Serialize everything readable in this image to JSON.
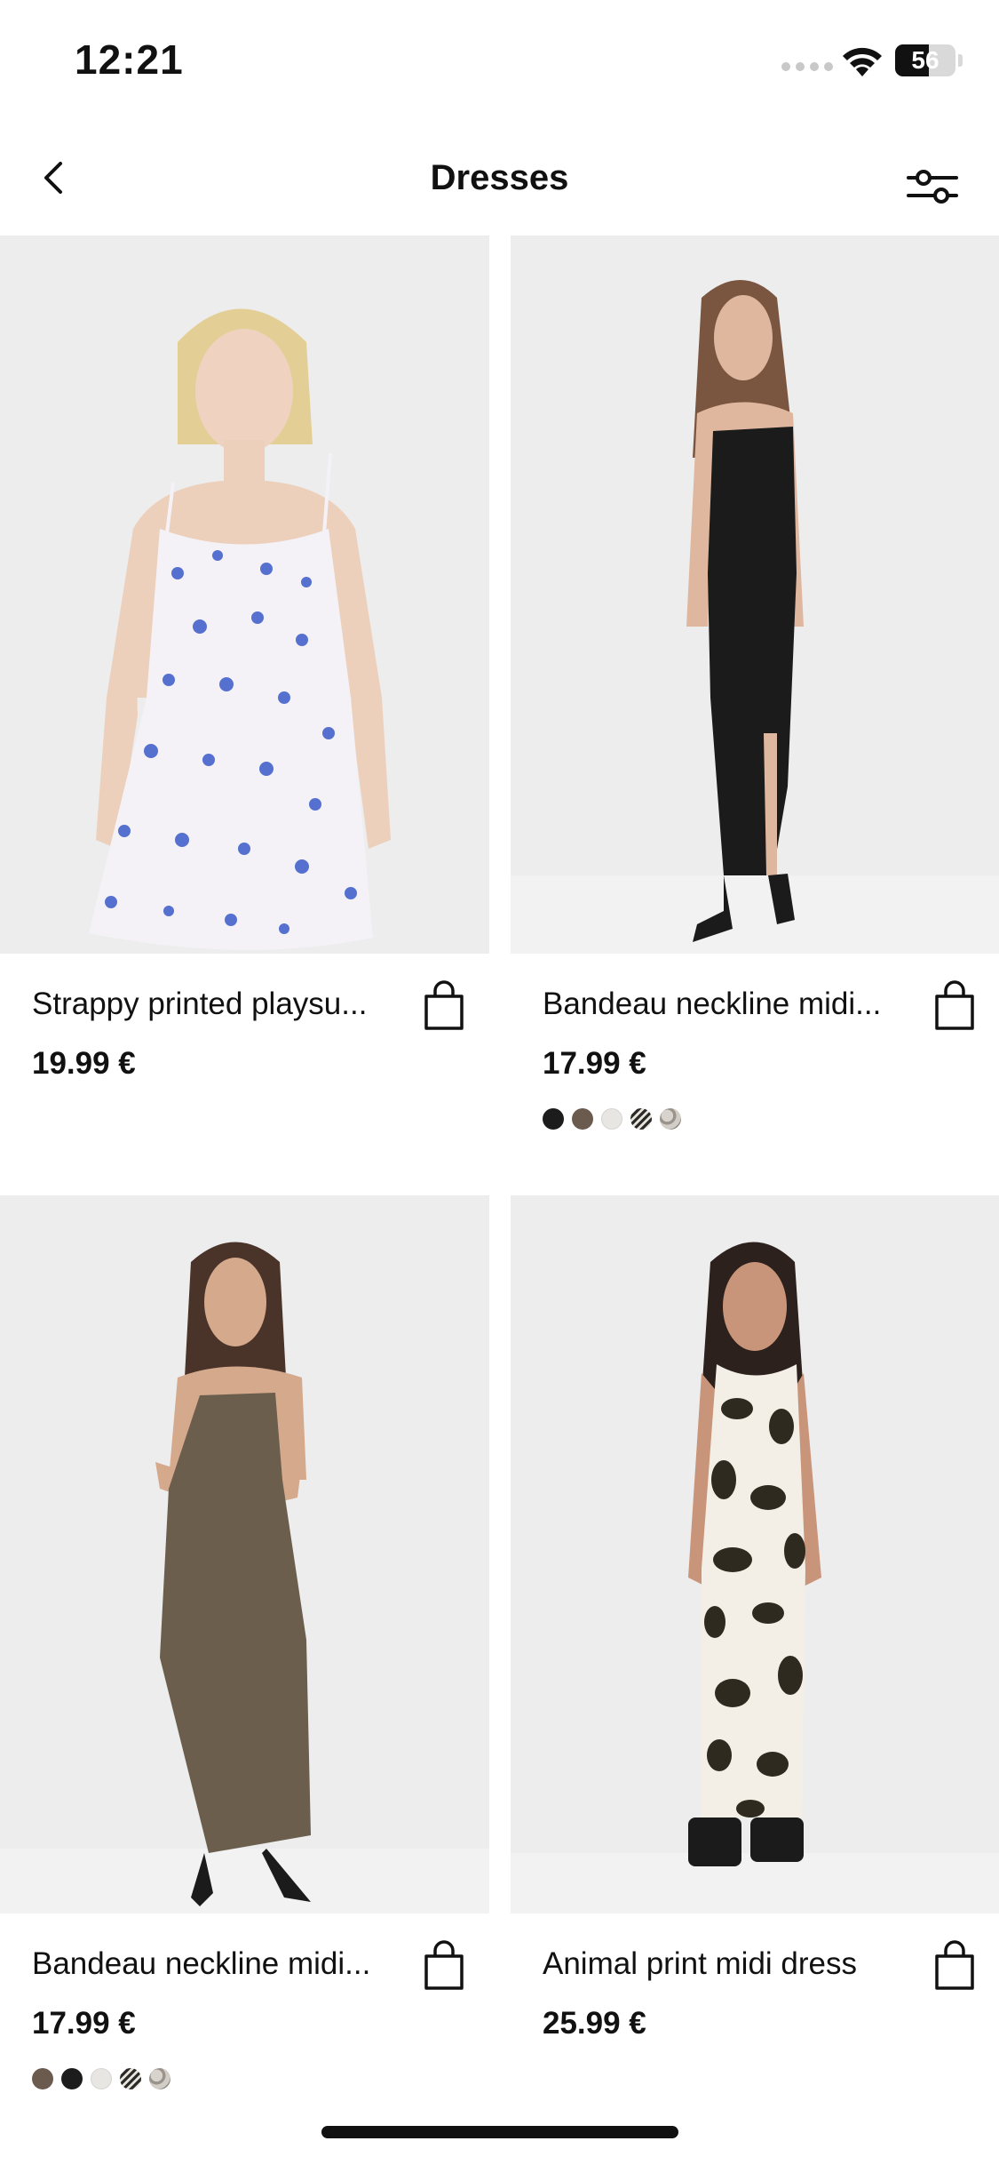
{
  "status_bar": {
    "time": "12:21",
    "battery": "56",
    "battery_level": 0.56
  },
  "header": {
    "title": "Dresses",
    "back_icon": "chevron-left-icon",
    "filter_icon": "sliders-icon"
  },
  "products": [
    {
      "name": "Strappy printed playsu...",
      "price": "19.99 €",
      "image": "floral-playsuit",
      "swatches": []
    },
    {
      "name": "Bandeau neckline midi...",
      "price": "17.99 €",
      "image": "black-bandeau-dress",
      "swatches": [
        "#1c1c1c",
        "#6b5a4e",
        "#e8e6e2",
        "striped",
        "marbled"
      ]
    },
    {
      "name": "Bandeau neckline midi...",
      "price": "17.99 €",
      "image": "khaki-bandeau-dress",
      "swatches": [
        "#6b5a4e",
        "#1c1c1c",
        "#e8e6e2",
        "striped",
        "marbled"
      ]
    },
    {
      "name": "Animal print midi dress",
      "price": "25.99 €",
      "image": "animal-print-dress",
      "swatches": []
    }
  ]
}
